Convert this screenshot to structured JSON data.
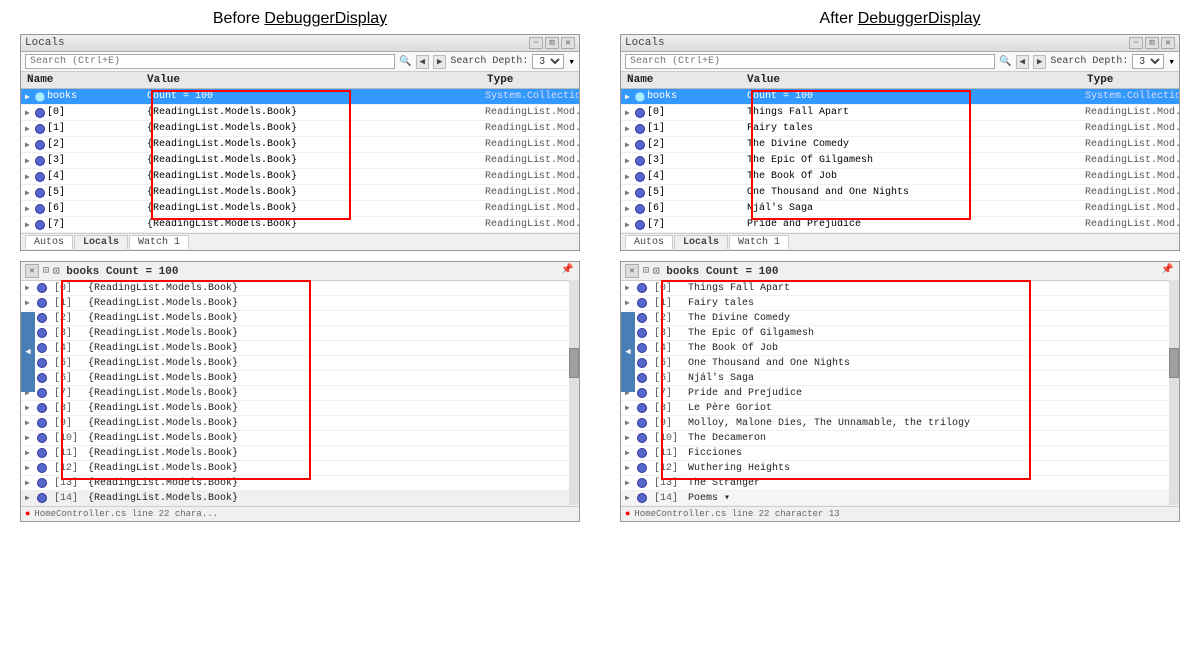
{
  "page": {
    "left_title": "Before DebuggerDisplay",
    "right_title": "After DebuggerDisplay"
  },
  "left_top": {
    "window_title": "Locals",
    "search_placeholder": "Search (Ctrl+E)",
    "search_depth_label": "Search Depth:",
    "search_depth_value": "3",
    "header_name": "Name",
    "header_value": "Value",
    "header_type": "Type",
    "books_row": {
      "name": "books",
      "value": "Count = 100",
      "type": "System.Collection..."
    },
    "rows": [
      {
        "index": "[0]",
        "value": "{ReadingList.Models.Book}",
        "type": "ReadingList.Mod..."
      },
      {
        "index": "[1]",
        "value": "{ReadingList.Models.Book}",
        "type": "ReadingList.Mod..."
      },
      {
        "index": "[2]",
        "value": "{ReadingList.Models.Book}",
        "type": "ReadingList.Mod..."
      },
      {
        "index": "[3]",
        "value": "{ReadingList.Models.Book}",
        "type": "ReadingList.Mod..."
      },
      {
        "index": "[4]",
        "value": "{ReadingList.Models.Book}",
        "type": "ReadingList.Mod..."
      },
      {
        "index": "[5]",
        "value": "{ReadingList.Models.Book}",
        "type": "ReadingList.Mod..."
      },
      {
        "index": "[6]",
        "value": "{ReadingList.Models.Book}",
        "type": "ReadingList.Mod..."
      },
      {
        "index": "[7]",
        "value": "{ReadingList.Models.Book}",
        "type": "ReadingList.Mod..."
      }
    ],
    "tabs": [
      "Autos",
      "Locals",
      "Watch 1"
    ]
  },
  "right_top": {
    "window_title": "Locals",
    "search_placeholder": "Search (Ctrl+E)",
    "search_depth_label": "Search Depth:",
    "search_depth_value": "3",
    "header_name": "Name",
    "header_value": "Value",
    "header_type": "Type",
    "books_row": {
      "name": "books",
      "value": "Count = 100",
      "type": "System.Collection..."
    },
    "rows": [
      {
        "index": "[0]",
        "value": "Things Fall Apart",
        "type": "ReadingList.Mod..."
      },
      {
        "index": "[1]",
        "value": "Fairy tales",
        "type": "ReadingList.Mod..."
      },
      {
        "index": "[2]",
        "value": "The Divine Comedy",
        "type": "ReadingList.Mod..."
      },
      {
        "index": "[3]",
        "value": "The Epic Of Gilgamesh",
        "type": "ReadingList.Mod..."
      },
      {
        "index": "[4]",
        "value": "The Book Of Job",
        "type": "ReadingList.Mod..."
      },
      {
        "index": "[5]",
        "value": "One Thousand and One Nights",
        "type": "ReadingList.Mod..."
      },
      {
        "index": "[6]",
        "value": "Njál's Saga",
        "type": "ReadingList.Mod..."
      },
      {
        "index": "[7]",
        "value": "Pride and Prejudice",
        "type": "ReadingList.Mod..."
      }
    ],
    "tabs": [
      "Autos",
      "Locals",
      "Watch 1"
    ]
  },
  "left_bottom": {
    "tooltip_title": "books  Count = 100",
    "rows": [
      {
        "index": "[0]",
        "value": "{ReadingList.Models.Book}"
      },
      {
        "index": "[1]",
        "value": "{ReadingList.Models.Book}"
      },
      {
        "index": "[2]",
        "value": "{ReadingList.Models.Book}"
      },
      {
        "index": "[3]",
        "value": "{ReadingList.Models.Book}"
      },
      {
        "index": "[4]",
        "value": "{ReadingList.Models.Book}"
      },
      {
        "index": "[5]",
        "value": "{ReadingList.Models.Book}"
      },
      {
        "index": "[6]",
        "value": "{ReadingList.Models.Book}"
      },
      {
        "index": "[7]",
        "value": "{ReadingList.Models.Book}"
      },
      {
        "index": "[8]",
        "value": "{ReadingList.Models.Book}"
      },
      {
        "index": "[9]",
        "value": "{ReadingList.Models.Book}"
      },
      {
        "index": "[10]",
        "value": "{ReadingList.Models.Book}"
      },
      {
        "index": "[11]",
        "value": "{ReadingList.Models.Book}"
      },
      {
        "index": "[12]",
        "value": "{ReadingList.Models.Book}"
      },
      {
        "index": "[13]",
        "value": "{ReadingList.Models.Book}"
      },
      {
        "index": "[14]",
        "value": "{ReadingList.Models.Book}"
      }
    ],
    "footer_text": "HomeController.cs line 22 chara..."
  },
  "right_bottom": {
    "tooltip_title": "books  Count = 100",
    "rows": [
      {
        "index": "[0]",
        "value": "Things Fall Apart"
      },
      {
        "index": "[1]",
        "value": "Fairy tales"
      },
      {
        "index": "[2]",
        "value": "The Divine Comedy"
      },
      {
        "index": "[3]",
        "value": "The Epic Of Gilgamesh"
      },
      {
        "index": "[4]",
        "value": "The Book Of Job"
      },
      {
        "index": "[5]",
        "value": "One Thousand and One Nights"
      },
      {
        "index": "[6]",
        "value": "Njál's Saga"
      },
      {
        "index": "[7]",
        "value": "Pride and Prejudice"
      },
      {
        "index": "[8]",
        "value": "Le Père Goriot"
      },
      {
        "index": "[9]",
        "value": "Molloy, Malone Dies, The Unnamable, the trilogy"
      },
      {
        "index": "[10]",
        "value": "The Decameron"
      },
      {
        "index": "[11]",
        "value": "Ficciones"
      },
      {
        "index": "[12]",
        "value": "Wuthering Heights"
      },
      {
        "index": "[13]",
        "value": "The Stranger"
      },
      {
        "index": "[14]",
        "value": "Poems"
      }
    ],
    "footer_text": "HomeController.cs line 22 character 13"
  }
}
